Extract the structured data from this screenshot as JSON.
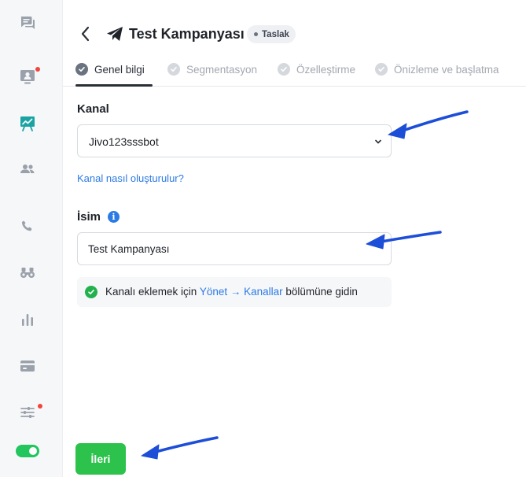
{
  "sidebar": {
    "items": [
      {
        "icon": "chat-messages-icon",
        "dot": false
      },
      {
        "icon": "contact-card-icon",
        "dot": true
      },
      {
        "icon": "campaign-board-icon",
        "dot": false,
        "active": true
      },
      {
        "icon": "users-icon",
        "dot": false
      },
      {
        "icon": "phone-icon",
        "dot": false
      },
      {
        "icon": "binoculars-icon",
        "dot": false
      },
      {
        "icon": "analytics-bars-icon",
        "dot": false
      },
      {
        "icon": "credit-card-icon",
        "dot": false
      },
      {
        "icon": "settings-sliders-icon",
        "dot": true
      }
    ],
    "toggle_on": true,
    "active_color": "#1aa3a3"
  },
  "header": {
    "title": "Test Kampanyası",
    "status": "Taslak"
  },
  "steps": [
    {
      "label": "Genel bilgi",
      "active": true
    },
    {
      "label": "Segmentasyon",
      "active": false
    },
    {
      "label": "Özelleştirme",
      "active": false
    },
    {
      "label": "Önizleme ve başlatma",
      "active": false
    }
  ],
  "form": {
    "channel_label": "Kanal",
    "channel_value": "Jivo123sssbot",
    "channel_help": "Kanal nasıl oluşturulur?",
    "name_label": "İsim",
    "name_value": "Test Kampanyası",
    "notice": {
      "before": "Kanalı eklemek için ",
      "link": "Yönet → Kanallar",
      "after": " bölümüne gidin"
    }
  },
  "footer": {
    "next_label": "İleri"
  },
  "colors": {
    "accent_blue": "#2c7be5",
    "primary_green": "#2cc24b",
    "annotation_arrow": "#1d4ed8"
  }
}
